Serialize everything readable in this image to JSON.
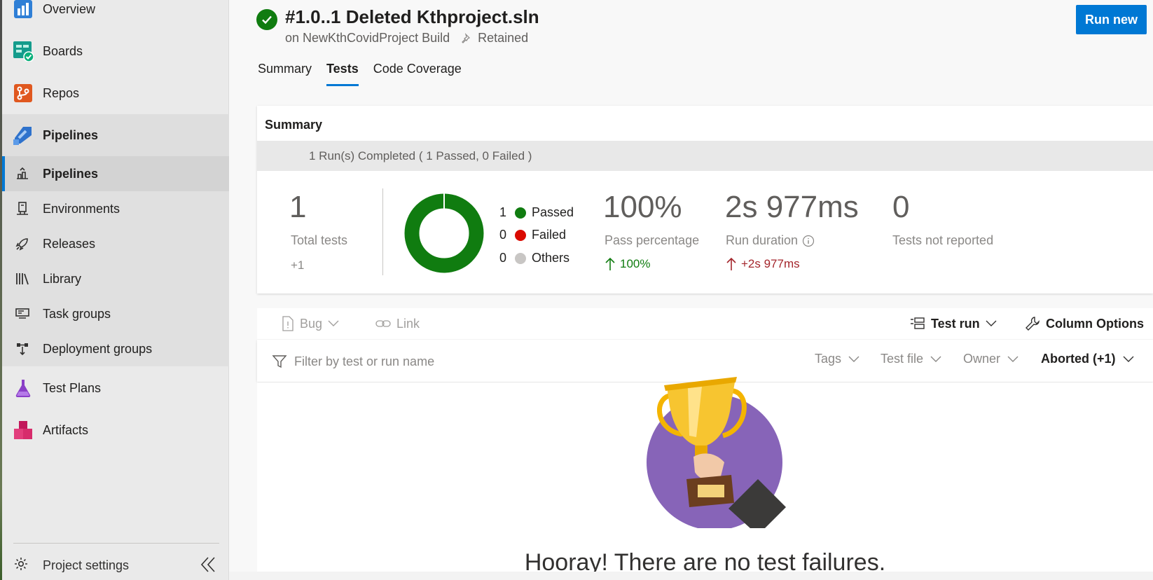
{
  "sidebar": {
    "top_items": [
      {
        "label": "Overview",
        "icon": "overview-icon"
      },
      {
        "label": "Boards",
        "icon": "boards-icon"
      },
      {
        "label": "Repos",
        "icon": "repos-icon"
      },
      {
        "label": "Pipelines",
        "icon": "pipelines-icon"
      }
    ],
    "pipeline_items": [
      {
        "label": "Pipelines",
        "icon": "pipeline-list-icon"
      },
      {
        "label": "Environments",
        "icon": "environments-icon"
      },
      {
        "label": "Releases",
        "icon": "rocket-icon"
      },
      {
        "label": "Library",
        "icon": "library-icon"
      },
      {
        "label": "Task groups",
        "icon": "task-groups-icon"
      },
      {
        "label": "Deployment groups",
        "icon": "deployment-groups-icon"
      }
    ],
    "bottom_items": [
      {
        "label": "Test Plans",
        "icon": "test-plans-icon"
      },
      {
        "label": "Artifacts",
        "icon": "artifacts-icon"
      }
    ],
    "settings_label": "Project settings"
  },
  "header": {
    "title": "#1.0..1 Deleted Kthproject.sln",
    "pipeline": "on NewKthCovidProject Build",
    "retained": "Retained",
    "run_new": "Run new"
  },
  "tabs": [
    "Summary",
    "Tests",
    "Code Coverage"
  ],
  "active_tab": "Tests",
  "summary": {
    "heading": "Summary",
    "band_text": "1 Run(s) Completed ( 1 Passed, 0 Failed )",
    "total_tests": "1",
    "total_tests_label": "Total tests",
    "total_delta": "+1",
    "legend": [
      {
        "count": "1",
        "label": "Passed",
        "color": "#107c10"
      },
      {
        "count": "0",
        "label": "Failed",
        "color": "#da0a00"
      },
      {
        "count": "0",
        "label": "Others",
        "color": "#c8c6c4"
      }
    ],
    "pass_pct": "100%",
    "pass_pct_label": "Pass percentage",
    "pass_delta": "100%",
    "duration": "2s 977ms",
    "duration_label": "Run duration",
    "duration_delta": "+2s 977ms",
    "not_reported": "0",
    "not_reported_label": "Tests not reported",
    "colors": {
      "positive": "#107c10",
      "negative": "#a4262c",
      "donut": "#107c10"
    }
  },
  "toolbar": {
    "bug": "Bug",
    "link": "Link",
    "test_run": "Test run",
    "column_options": "Column Options"
  },
  "filter": {
    "placeholder": "Filter by test or run name",
    "tags": "Tags",
    "test_file": "Test file",
    "owner": "Owner",
    "outcome": "Aborted (+1)"
  },
  "empty_state": {
    "message": "Hooray! There are no test failures."
  },
  "accent": "#0078d4"
}
